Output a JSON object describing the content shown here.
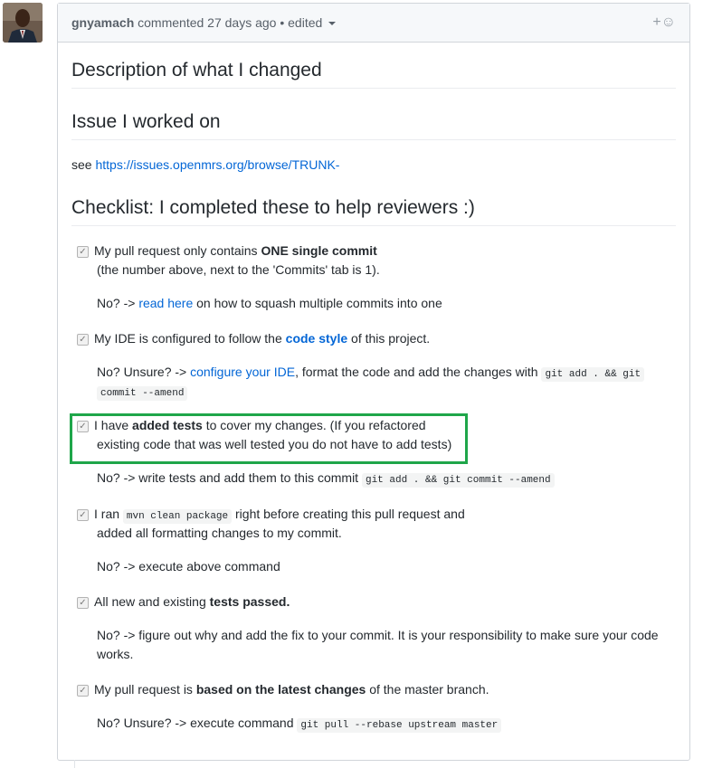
{
  "comment": {
    "author": "gnyamach",
    "meta": "commented 27 days ago • edited",
    "reaction_icon": "smiley-plus-icon"
  },
  "headings": {
    "description": "Description of what I changed",
    "issue": "Issue I worked on",
    "checklist": "Checklist: I completed these to help reviewers :)"
  },
  "issue_line": {
    "prefix": "see ",
    "link": "https://issues.openmrs.org/browse/TRUNK-"
  },
  "items": [
    {
      "line1_a": "My pull request only contains ",
      "line1_b": "ONE single commit",
      "line2": "(the number above, next to the 'Commits' tab is 1).",
      "no_a": "No? -> ",
      "no_link": "read here",
      "no_b": " on how to squash multiple commits into one"
    },
    {
      "line1_a": "My IDE is configured to follow the ",
      "line1_link": "code style",
      "line1_b": " of this project.",
      "no_a": "No? Unsure? -> ",
      "no_link": "configure your IDE",
      "no_b": ", format the code and add the changes with ",
      "no_code1": "git add . && git",
      "no_code2": "commit --amend"
    },
    {
      "line1_a": "I have ",
      "line1_b": "added tests",
      "line1_c": " to cover my changes. (If you refactored",
      "line2": "existing code that was well tested you do not have to add tests)",
      "no_a": "No? -> write tests and add them to this commit ",
      "no_code": "git add . && git commit --amend"
    },
    {
      "line1_a": "I ran ",
      "line1_code": "mvn clean package",
      "line1_b": " right before creating this pull request and",
      "line2": "added all formatting changes to my commit.",
      "no_a": "No? -> execute above command"
    },
    {
      "line1_a": "All new and existing ",
      "line1_b": "tests passed.",
      "no_line1": "No? -> figure out why and add the fix to your commit. It is your responsibility to make sure your code",
      "no_line2": "works."
    },
    {
      "line1_a": "My pull request is ",
      "line1_b": "based on the latest changes",
      "line1_c": " of the master branch.",
      "no_a": "No? Unsure? -> execute command ",
      "no_code": "git pull --rebase upstream master"
    }
  ],
  "highlight_color": "#1fa64a"
}
